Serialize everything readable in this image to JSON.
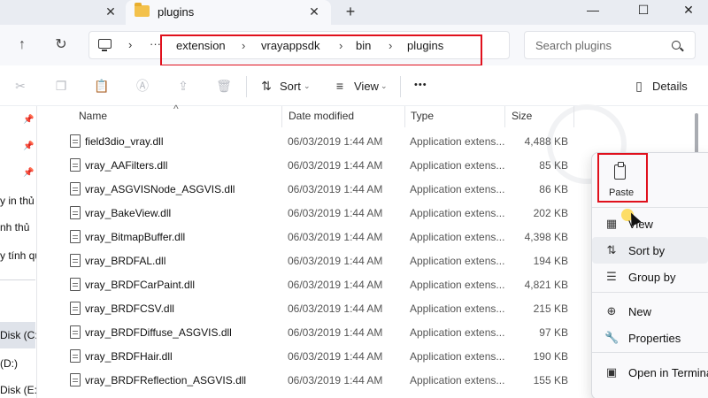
{
  "tab": {
    "title": "plugins"
  },
  "address": {
    "crumbs": [
      "extension",
      "vrayappsdk",
      "bin",
      "plugins"
    ],
    "ellipsis": "···"
  },
  "search": {
    "placeholder": "Search plugins"
  },
  "toolbar": {
    "sort_label": "Sort",
    "view_label": "View",
    "more_label": "•••",
    "details_label": "Details"
  },
  "sidebar": {
    "items": [
      "y in thủ c",
      "nh thủ",
      "y tính qu",
      "Disk (C:)",
      "(D:)",
      "Disk (E:)"
    ]
  },
  "columns": {
    "name": "Name",
    "date": "Date modified",
    "type": "Type",
    "size": "Size"
  },
  "files": [
    {
      "name": "field3dio_vray.dll",
      "date": "06/03/2019 1:44 AM",
      "type": "Application extens...",
      "size": "4,488 KB"
    },
    {
      "name": "vray_AAFilters.dll",
      "date": "06/03/2019 1:44 AM",
      "type": "Application extens...",
      "size": "85 KB"
    },
    {
      "name": "vray_ASGVISNode_ASGVIS.dll",
      "date": "06/03/2019 1:44 AM",
      "type": "Application extens...",
      "size": "86 KB"
    },
    {
      "name": "vray_BakeView.dll",
      "date": "06/03/2019 1:44 AM",
      "type": "Application extens...",
      "size": "202 KB"
    },
    {
      "name": "vray_BitmapBuffer.dll",
      "date": "06/03/2019 1:44 AM",
      "type": "Application extens...",
      "size": "4,398 KB"
    },
    {
      "name": "vray_BRDFAL.dll",
      "date": "06/03/2019 1:44 AM",
      "type": "Application extens...",
      "size": "194 KB"
    },
    {
      "name": "vray_BRDFCarPaint.dll",
      "date": "06/03/2019 1:44 AM",
      "type": "Application extens...",
      "size": "4,821 KB"
    },
    {
      "name": "vray_BRDFCSV.dll",
      "date": "06/03/2019 1:44 AM",
      "type": "Application extens...",
      "size": "215 KB"
    },
    {
      "name": "vray_BRDFDiffuse_ASGVIS.dll",
      "date": "06/03/2019 1:44 AM",
      "type": "Application extens...",
      "size": "97 KB"
    },
    {
      "name": "vray_BRDFHair.dll",
      "date": "06/03/2019 1:44 AM",
      "type": "Application extens...",
      "size": "190 KB"
    },
    {
      "name": "vray_BRDFReflection_ASGVIS.dll",
      "date": "06/03/2019 1:44 AM",
      "type": "Application extens...",
      "size": "155 KB"
    }
  ],
  "context_menu": {
    "paste_label": "Paste",
    "items": [
      {
        "icon": "view-icon",
        "label": "View"
      },
      {
        "icon": "sort-icon",
        "label": "Sort by"
      },
      {
        "icon": "group-icon",
        "label": "Group by"
      },
      {
        "icon": "new-icon",
        "label": "New"
      },
      {
        "icon": "properties-icon",
        "label": "Properties"
      },
      {
        "icon": "terminal-icon",
        "label": "Open in Terminal"
      }
    ]
  },
  "colors": {
    "highlight_box": "#e0101c",
    "folder": "#f3c14b"
  }
}
